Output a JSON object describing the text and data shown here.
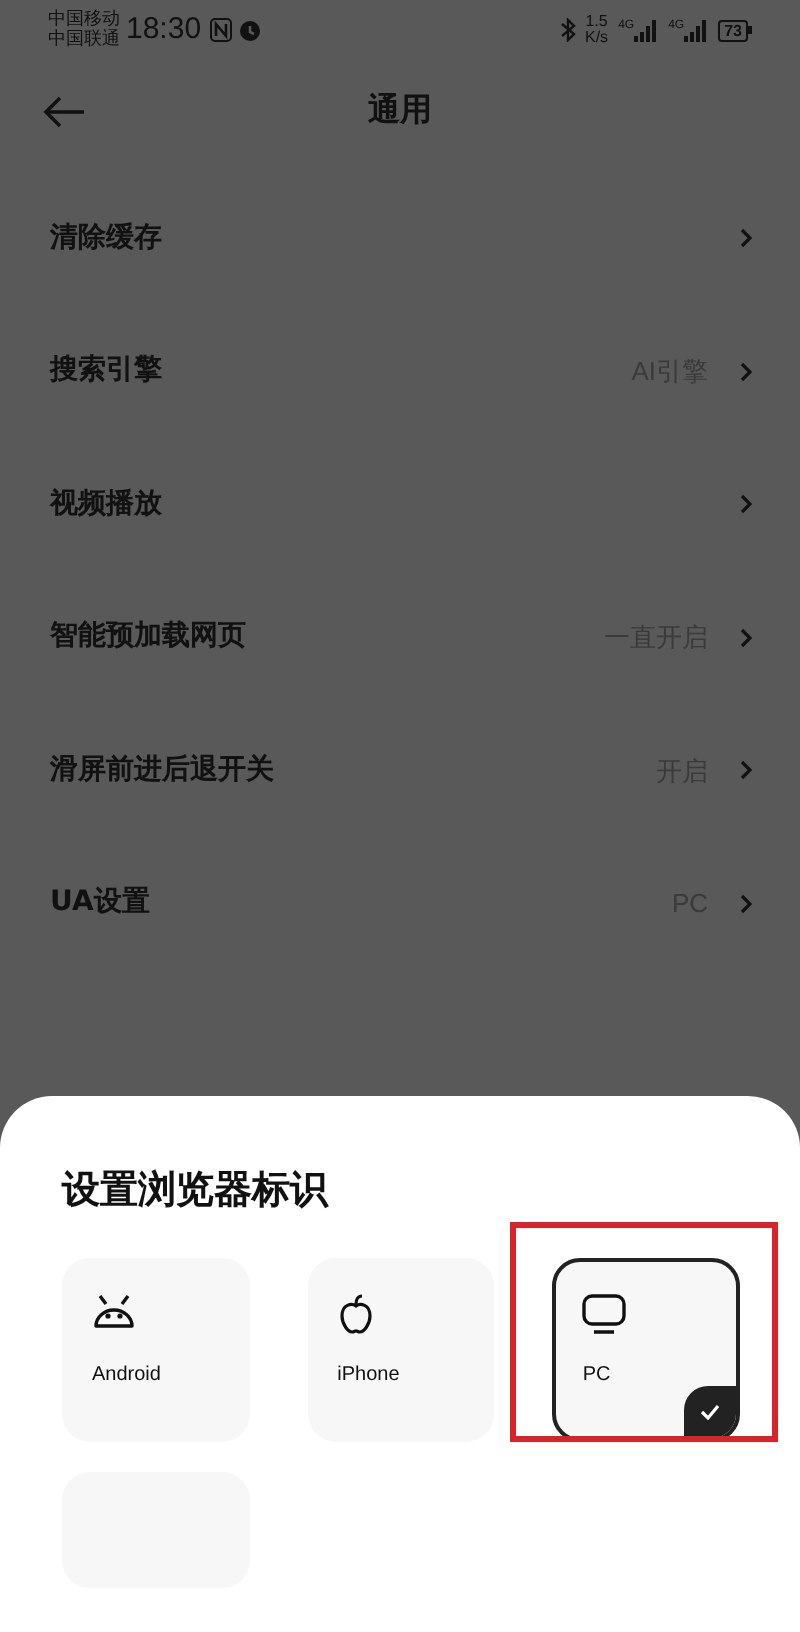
{
  "status_bar": {
    "carriers": [
      "中国移动",
      "中国联通"
    ],
    "time": "18:30",
    "speed": [
      "1.5",
      "K/s"
    ],
    "network_labels": [
      "4G",
      "4G"
    ],
    "battery": "73"
  },
  "header": {
    "title": "通用"
  },
  "settings": [
    {
      "label": "清除缓存"
    },
    {
      "label": "搜索引擎",
      "value": "AI引擎"
    },
    {
      "label": "视频播放"
    },
    {
      "label": "智能预加载网页",
      "value": "一直开启"
    },
    {
      "label": "滑屏前进后退开关",
      "value": "开启"
    },
    {
      "label": "UA设置",
      "value": "PC"
    }
  ],
  "sheet": {
    "title": "设置浏览器标识",
    "options": [
      {
        "kind": "android",
        "label": "Android",
        "selected": false
      },
      {
        "kind": "apple",
        "label": "iPhone",
        "selected": false
      },
      {
        "kind": "pc",
        "label": "PC",
        "selected": true
      },
      {
        "kind": "blank"
      }
    ],
    "highlight": true
  }
}
